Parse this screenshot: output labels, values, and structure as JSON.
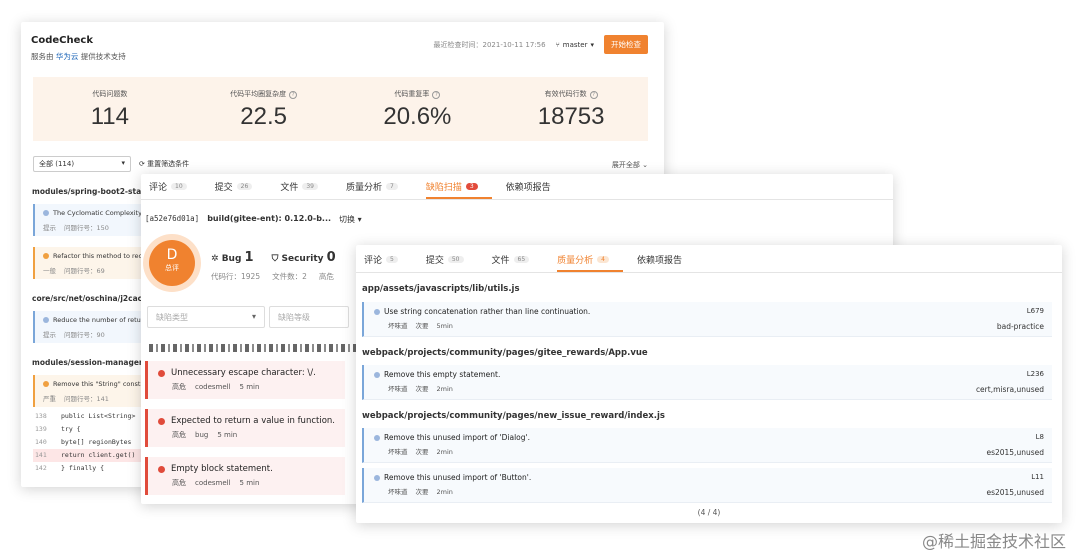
{
  "panel1": {
    "title": "CodeCheck",
    "subtitle_prefix": "服务由",
    "subtitle_brand": "华为云",
    "subtitle_suffix": "提供技术支持",
    "last_check_label": "最近检查时间：2021-10-11 17:56",
    "branch": "master",
    "start_button": "开始检查",
    "stats": [
      {
        "label": "代码问题数",
        "value": "114"
      },
      {
        "label": "代码平均圈复杂度",
        "value": "22.5"
      },
      {
        "label": "代码重复率",
        "value": "20.6%"
      },
      {
        "label": "有效代码行数",
        "value": "18753"
      }
    ],
    "filter_select": "全部 (114)",
    "reset_filter": "重置筛选条件",
    "expand_all": "展开全部",
    "sections": [
      {
        "path": "modules/spring-boot2-starte",
        "cards": [
          {
            "text": "The Cyclomatic Complexity",
            "level": "提示",
            "line": "问题行号：150"
          },
          {
            "text": "Refactor this method to rec",
            "level": "一般",
            "line": "问题行号：69"
          }
        ]
      },
      {
        "path": "core/src/net/oschina/j2cache",
        "cards": [
          {
            "text": "Reduce the number of retu",
            "level": "提示",
            "line": "问题行号：90"
          }
        ]
      },
      {
        "path": "modules/session-manager/sr",
        "cards": [
          {
            "text": "Remove this \"String\" constr",
            "level": "严重",
            "line": "问题行号：141"
          }
        ]
      }
    ],
    "code": [
      {
        "ln": "138",
        "text": "public List<String>"
      },
      {
        "ln": "139",
        "text": "try {"
      },
      {
        "ln": "140",
        "text": "byte[] regionBytes"
      },
      {
        "ln": "141",
        "text": "return client.get()"
      },
      {
        "ln": "142",
        "text": "} finally {"
      }
    ]
  },
  "panel2": {
    "tabs": [
      {
        "label": "评论",
        "count": "10"
      },
      {
        "label": "提交",
        "count": "26"
      },
      {
        "label": "文件",
        "count": "39"
      },
      {
        "label": "质量分析",
        "count": "7"
      },
      {
        "label": "缺陷扫描",
        "count": "3"
      },
      {
        "label": "依赖项报告",
        "count": ""
      }
    ],
    "commit_hash": "[a52e76d01a]",
    "commit_msg": "build(gitee-ent): 0.12.0-b...",
    "switch_label": "切换",
    "grade": "D",
    "grade_label": "总评",
    "bug_label": "Bug",
    "bug_count": "1",
    "security_label": "Security",
    "security_count": "0",
    "lines_label": "代码行：",
    "lines": "1925",
    "files_label": "文件数：",
    "files": "2",
    "hot_label": "高危",
    "type_placeholder": "缺陷类型",
    "level_placeholder": "缺陷等级",
    "issues": [
      {
        "title": "Unnecessary escape character: \\/.",
        "level": "高危",
        "kind": "codesmell",
        "time": "5 min"
      },
      {
        "title": "Expected to return a value in function.",
        "level": "高危",
        "kind": "bug",
        "time": "5 min"
      },
      {
        "title": "Empty block statement.",
        "level": "高危",
        "kind": "codesmell",
        "time": "5 min"
      }
    ]
  },
  "panel3": {
    "tabs": [
      {
        "label": "评论",
        "count": "5"
      },
      {
        "label": "提交",
        "count": "50"
      },
      {
        "label": "文件",
        "count": "65"
      },
      {
        "label": "质量分析",
        "count": "4"
      },
      {
        "label": "依赖项报告",
        "count": ""
      }
    ],
    "sections": [
      {
        "path": "app/assets/javascripts/lib/utils.js",
        "cards": [
          {
            "text": "Use string concatenation rather than line continuation.",
            "kind": "坏味道",
            "sev": "次要",
            "time": "5min",
            "line": "L679",
            "tags": "bad-practice"
          }
        ]
      },
      {
        "path": "webpack/projects/community/pages/gitee_rewards/App.vue",
        "cards": [
          {
            "text": "Remove this empty statement.",
            "kind": "坏味道",
            "sev": "次要",
            "time": "2min",
            "line": "L236",
            "tags": "cert,misra,unused"
          }
        ]
      },
      {
        "path": "webpack/projects/community/pages/new_issue_reward/index.js",
        "cards": [
          {
            "text": "Remove this unused import of 'Dialog'.",
            "kind": "坏味道",
            "sev": "次要",
            "time": "2min",
            "line": "L8",
            "tags": "es2015,unused"
          },
          {
            "text": "Remove this unused import of 'Button'.",
            "kind": "坏味道",
            "sev": "次要",
            "time": "2min",
            "line": "L11",
            "tags": "es2015,unused"
          }
        ]
      }
    ],
    "pager": "(4 / 4)"
  },
  "watermark": "@稀土掘金技术社区"
}
